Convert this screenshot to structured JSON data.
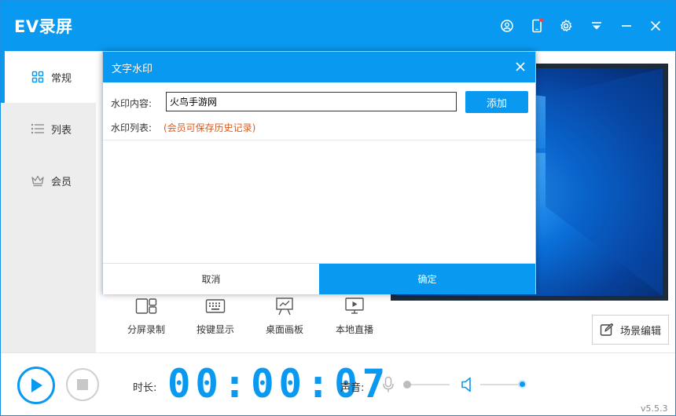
{
  "app": {
    "title": "EV录屏",
    "version": "v5.5.3",
    "accent_color": "#0a99f0",
    "titlebar_icons": [
      "user-icon",
      "phone-icon",
      "settings-icon",
      "dropdown-menu-icon",
      "minimize-icon",
      "close-icon"
    ]
  },
  "sidebar": {
    "items": [
      {
        "label": "常规",
        "icon": "grid-icon",
        "active": true
      },
      {
        "label": "列表",
        "icon": "list-icon",
        "active": false
      },
      {
        "label": "会员",
        "icon": "crown-icon",
        "active": false
      }
    ]
  },
  "tools": [
    {
      "label": "分屏录制",
      "icon": "split-screen-icon"
    },
    {
      "label": "按键显示",
      "icon": "keyboard-icon"
    },
    {
      "label": "桌面画板",
      "icon": "easel-icon"
    },
    {
      "label": "本地直播",
      "icon": "live-screen-icon"
    }
  ],
  "scene_edit": {
    "label": "场景编辑",
    "icon": "edit-icon"
  },
  "bottom": {
    "duration_label": "时长:",
    "timer": "00:00:07",
    "sound_label": "声音:",
    "mic_level": 0,
    "speaker_level": 1
  },
  "dialog": {
    "title": "文字水印",
    "content_label": "水印内容:",
    "content_value": "火鸟手游网",
    "add_label": "添加",
    "list_label": "水印列表:",
    "list_hint": "(会员可保存历史记录)",
    "cancel_label": "取消",
    "ok_label": "确定"
  }
}
